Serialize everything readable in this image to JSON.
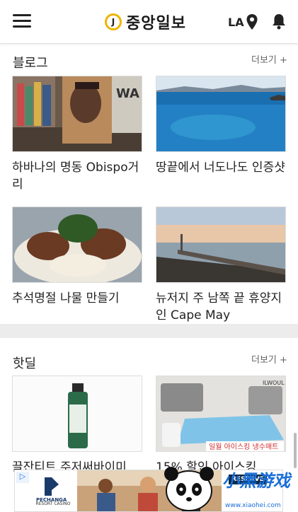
{
  "header": {
    "logo_mark": "J",
    "logo_text": "중앙일보",
    "region": "LA"
  },
  "sections": [
    {
      "title": "블로그",
      "more": "더보기 +",
      "cards": [
        {
          "title": "하바나의 명동 Obispo거리",
          "image": "street-mural-photo"
        },
        {
          "title": "땅끝에서 너도나도 인증샷",
          "image": "ocean-coast-photo"
        },
        {
          "title": "추석명절 나물 만들기",
          "image": "noodle-dish-photo"
        },
        {
          "title": "뉴저지 주 남쪽 끝 휴양지인 Cape May",
          "image": "jetty-sunset-photo"
        }
      ]
    },
    {
      "title": "핫딜",
      "more": "더보기 +",
      "cards": [
        {
          "title": "끌잔티트 주저써바이미",
          "image": "toner-bottle-photo"
        },
        {
          "title": "15% 할인 아이스킹",
          "image": "cooling-mat-photo",
          "caption_brand": "ILWOUL",
          "caption": "일월 아이스킹 냉수매트"
        }
      ]
    }
  ],
  "ad": {
    "badge": "▷",
    "brand": "PECHANGA",
    "brand_sub": "RESORT CASINO",
    "right_text": "RESERVE"
  },
  "watermark": {
    "text": "小黑游戏",
    "url": "www.xiaohei.com"
  }
}
